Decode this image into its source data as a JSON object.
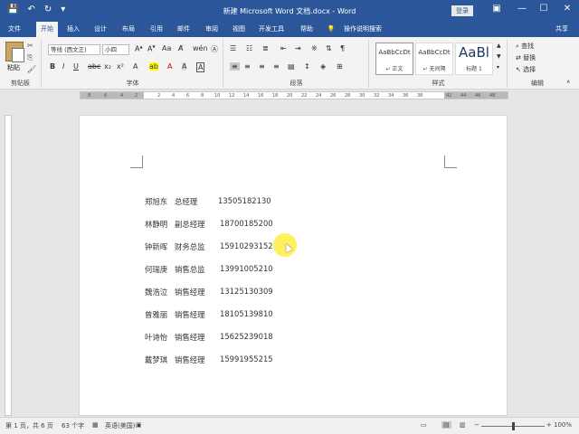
{
  "titlebar": {
    "title": "新建 Microsoft Word 文档.docx  -  Word",
    "login": "登录",
    "min": "—",
    "max": "☐",
    "close": "✕",
    "restore": "▣"
  },
  "tabs": [
    "文件",
    "开始",
    "插入",
    "设计",
    "布局",
    "引用",
    "邮件",
    "审阅",
    "视图",
    "开发工具",
    "帮助",
    "操作说明搜索"
  ],
  "share": "共享",
  "ribbon": {
    "clipboard": {
      "paste": "粘贴",
      "label": "剪贴板"
    },
    "font": {
      "name": "等线 (西文正)",
      "size": "小四",
      "label": "字体"
    },
    "paragraph": {
      "label": "段落"
    },
    "styles": {
      "label": "样式",
      "items": [
        {
          "sample": "AaBbCcDt",
          "name": "↵ 正文"
        },
        {
          "sample": "AaBbCcDt",
          "name": "↵ 无间隔"
        },
        {
          "sample": "AaBl",
          "name": "标题 1"
        }
      ]
    },
    "editing": {
      "find": "查找",
      "replace": "替换",
      "select": "选择",
      "label": "编辑"
    }
  },
  "ruler": [
    "8",
    "6",
    "4",
    "2",
    "2",
    "4",
    "6",
    "8",
    "10",
    "12",
    "14",
    "16",
    "18",
    "20",
    "22",
    "24",
    "26",
    "28",
    "30",
    "32",
    "34",
    "36",
    "38",
    "42",
    "44",
    "46",
    "48"
  ],
  "document": {
    "rows": [
      {
        "name": "郑旭东",
        "title": "总经理",
        "phone": "13505182130"
      },
      {
        "name": "林静明",
        "title": "副总经理",
        "phone": "18700185200"
      },
      {
        "name": "钟新晖",
        "title": "财务总监",
        "phone": "15910293152"
      },
      {
        "name": "何瑞庚",
        "title": "销售总监",
        "phone": "13991005210"
      },
      {
        "name": "魏浩泣",
        "title": "销售经理",
        "phone": "13125130309"
      },
      {
        "name": "曾雅丽",
        "title": "销售经理",
        "phone": "18105139810"
      },
      {
        "name": "叶诗怡",
        "title": "销售经理",
        "phone": "15625239018"
      },
      {
        "name": "戴梦琪",
        "title": "销售经理",
        "phone": "15991955215"
      }
    ]
  },
  "status": {
    "page": "第 1 页，共 6 页",
    "words": "63 个字",
    "lang": "英语(美国)",
    "zoom": "100%"
  }
}
